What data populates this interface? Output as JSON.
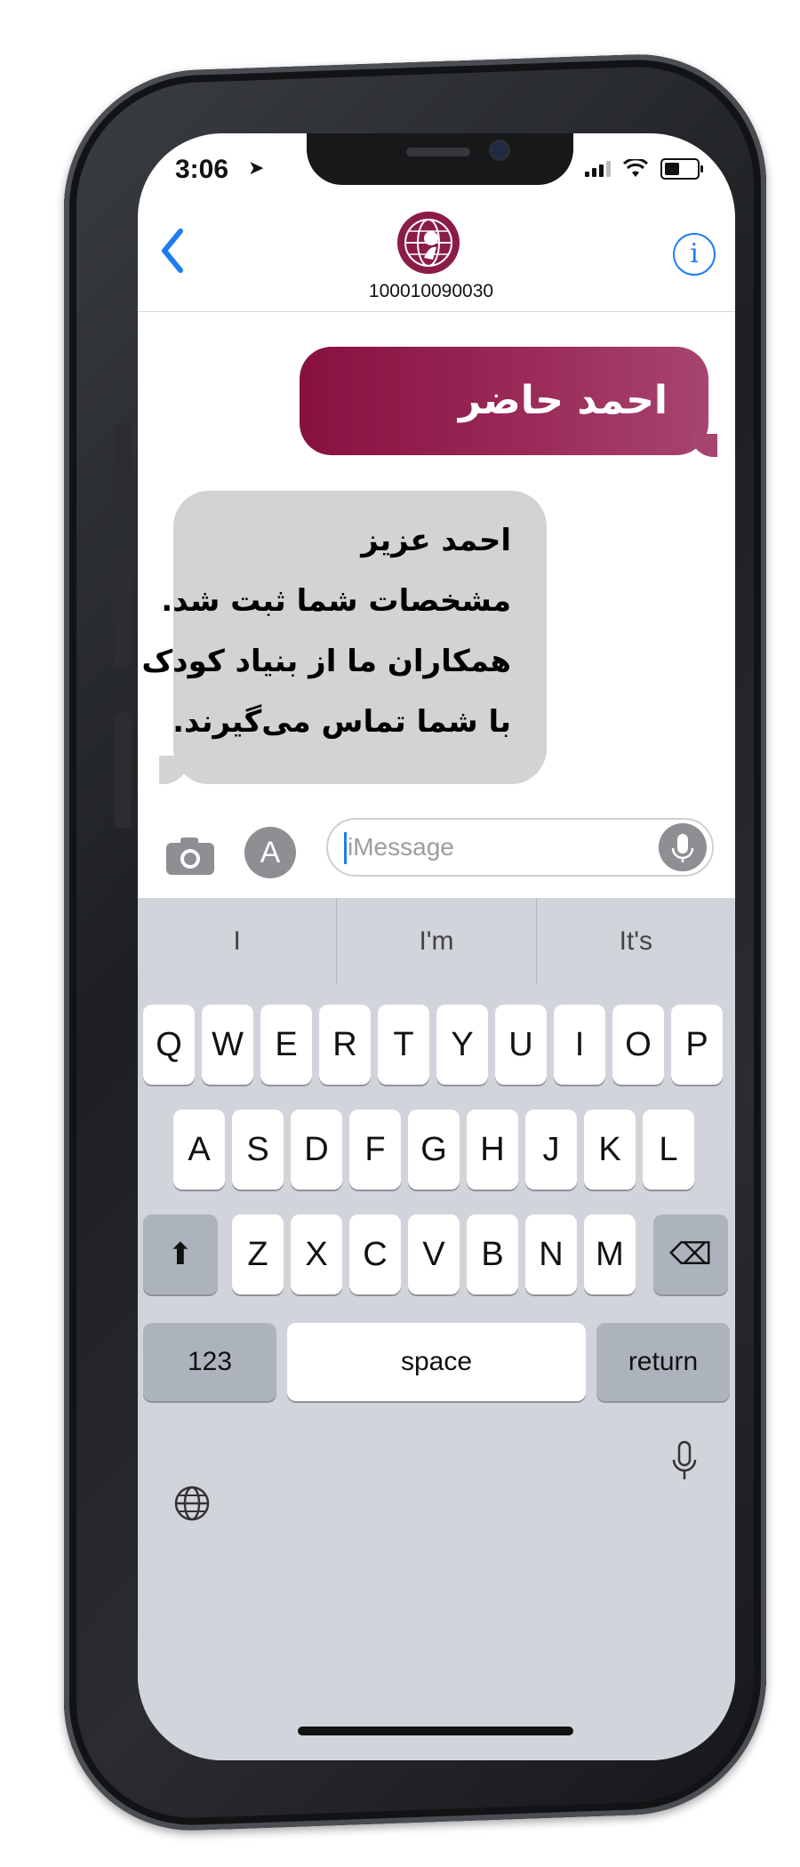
{
  "status_bar": {
    "time": "3:06",
    "location_icon": "location-arrow-icon",
    "signal_icon": "cellular-signal-icon",
    "wifi_icon": "wifi-icon",
    "battery_icon": "battery-icon"
  },
  "nav": {
    "back_icon": "chevron-left-icon",
    "contact_number": "100010090030",
    "info_icon": "info-icon",
    "info_glyph": "i",
    "avatar_icon": "globe-logo-icon"
  },
  "messages": {
    "outgoing": {
      "text": "احمد حاضر",
      "color_start": "#87103f",
      "color_end": "#a74470"
    },
    "incoming": {
      "lines": [
        "احمد عزیز",
        "مشخصات شما ثبت شد.",
        "همکاران ما از بنیاد کودک",
        "با شما تماس می‌گیرند."
      ],
      "color": "#d3d3d3"
    }
  },
  "composer": {
    "camera_icon": "camera-icon",
    "appstore_icon": "appstore-icon",
    "appstore_glyph": "A",
    "placeholder": "iMessage",
    "mic_icon": "microphone-icon"
  },
  "keyboard": {
    "predictions": [
      "I",
      "I'm",
      "It's"
    ],
    "row1": [
      "Q",
      "W",
      "E",
      "R",
      "T",
      "Y",
      "U",
      "I",
      "O",
      "P"
    ],
    "row2": [
      "A",
      "S",
      "D",
      "F",
      "G",
      "H",
      "J",
      "K",
      "L"
    ],
    "row3": [
      "Z",
      "X",
      "C",
      "V",
      "B",
      "N",
      "M"
    ],
    "shift_glyph": "⬆",
    "delete_glyph": "⌫",
    "numbers_label": "123",
    "space_label": "space",
    "return_label": "return",
    "globe_icon": "globe-icon",
    "dictation_icon": "microphone-icon"
  },
  "colors": {
    "accent_blue": "#1e7cf2",
    "keyboard_bg": "#d1d4da"
  }
}
